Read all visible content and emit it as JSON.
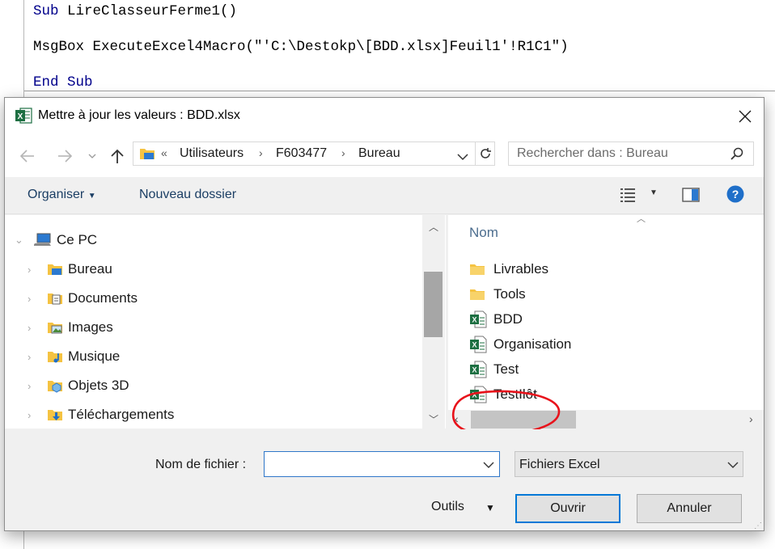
{
  "editor": {
    "line1": {
      "keyword": "Sub",
      "rest": " LireClasseurFerme1()"
    },
    "line2": {
      "text": "MsgBox ExecuteExcel4Macro(\"'C:\\Destokp\\[BDD.xlsx]Feuil1'!R1C1\")"
    },
    "line3": {
      "keyword": "End Sub"
    }
  },
  "dialog": {
    "title": "Mettre à jour les valeurs : BDD.xlsx",
    "address": {
      "prefix": "«",
      "crumbs": [
        "Utilisateurs",
        "F603477",
        "Bureau"
      ]
    },
    "search_placeholder": "Rechercher dans : Bureau",
    "toolbar": {
      "organize": "Organiser",
      "new_folder": "Nouveau dossier"
    },
    "tree": [
      {
        "label": "Ce PC",
        "icon": "computer-icon"
      },
      {
        "label": "Bureau",
        "icon": "desktop-folder-icon"
      },
      {
        "label": "Documents",
        "icon": "documents-folder-icon"
      },
      {
        "label": "Images",
        "icon": "pictures-folder-icon"
      },
      {
        "label": "Musique",
        "icon": "music-folder-icon"
      },
      {
        "label": "Objets 3D",
        "icon": "3d-objects-folder-icon"
      },
      {
        "label": "Téléchargements",
        "icon": "downloads-folder-icon"
      }
    ],
    "files_header": "Nom",
    "files": [
      {
        "name": "Livrables",
        "type": "folder"
      },
      {
        "name": "Tools",
        "type": "folder"
      },
      {
        "name": "BDD",
        "type": "excel"
      },
      {
        "name": "Organisation",
        "type": "excel"
      },
      {
        "name": "Test",
        "type": "excel"
      },
      {
        "name": "TestIlôt",
        "type": "excel"
      }
    ],
    "filename_label": "Nom de fichier :",
    "filename_value": "",
    "filetype": "Fichiers Excel",
    "tools": "Outils",
    "open": "Ouvrir",
    "cancel": "Annuler"
  },
  "colors": {
    "excel_green": "#1d6f42",
    "folder_yellow": "#f5c342",
    "accent_blue": "#0078d7",
    "annotation_red": "#e8121b",
    "vba_keyword": "#00008b"
  }
}
